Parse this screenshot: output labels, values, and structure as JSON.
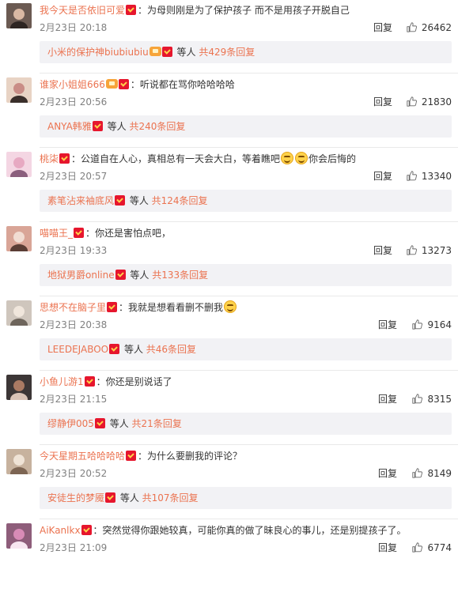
{
  "comments": [
    {
      "user": "我今天是否依旧可爱",
      "vip": false,
      "text": "：为母则刚是为了保护孩子 而不是用孩子开脱自己",
      "emoji": 0,
      "text_after": "",
      "date": "2月23日 20:18",
      "reply": "回复",
      "likes": "26462",
      "sub": {
        "name": "小米的保护神biubiubiu",
        "vip": true,
        "mid": " 等人 ",
        "count": "共429条回复"
      }
    },
    {
      "user": "谁家小姐姐666",
      "vip": true,
      "text": "：听说都在骂你哈哈哈哈",
      "emoji": 0,
      "text_after": "",
      "date": "2月23日 20:56",
      "reply": "回复",
      "likes": "21830",
      "sub": {
        "name": "ANYA韩雅",
        "vip": false,
        "mid": " 等人 ",
        "count": "共240条回复"
      }
    },
    {
      "user": "桃柒",
      "vip": false,
      "text": "：公道自在人心，真相总有一天会大白，等着瞧吧",
      "emoji": 2,
      "text_after": "你会后悔的",
      "date": "2月23日 20:57",
      "reply": "回复",
      "likes": "13340",
      "sub": {
        "name": "素笔沾来袖底风",
        "vip": false,
        "mid": " 等人 ",
        "count": "共124条回复"
      }
    },
    {
      "user": "喵喵王_",
      "vip": false,
      "text": "：你还是害怕点吧，",
      "emoji": 0,
      "text_after": "",
      "date": "2月23日 19:33",
      "reply": "回复",
      "likes": "13273",
      "sub": {
        "name": "地狱男爵online",
        "vip": false,
        "mid": " 等人 ",
        "count": "共133条回复"
      }
    },
    {
      "user": "思想不在脑子里",
      "vip": false,
      "text": "：我就是想看看删不删我",
      "emoji": 1,
      "text_after": "",
      "date": "2月23日 20:38",
      "reply": "回复",
      "likes": "9164",
      "sub": {
        "name": "LEEDEJABOO",
        "vip": false,
        "mid": " 等人 ",
        "count": "共46条回复"
      }
    },
    {
      "user": "小鱼儿游1",
      "vip": false,
      "text": "：你还是别说话了",
      "emoji": 0,
      "text_after": "",
      "date": "2月23日 21:15",
      "reply": "回复",
      "likes": "8315",
      "sub": {
        "name": "缪静伊005",
        "vip": false,
        "mid": " 等人 ",
        "count": "共21条回复"
      }
    },
    {
      "user": "今天星期五哈哈哈哈",
      "vip": false,
      "text": "：为什么要删我的评论？",
      "emoji": 0,
      "text_after": "",
      "date": "2月23日 20:52",
      "reply": "回复",
      "likes": "8149",
      "sub": {
        "name": "安徒生的梦魇",
        "vip": false,
        "mid": " 等人 ",
        "count": "共107条回复"
      }
    },
    {
      "user": "AiKanlkx",
      "vip": false,
      "text": "：突然觉得你跟她较真，可能你真的做了昧良心的事儿，还是别提孩子了。",
      "emoji": 0,
      "text_after": "",
      "date": "2月23日 21:09",
      "reply": "回复",
      "likes": "6774",
      "sub": null
    }
  ],
  "colors": {
    "username": "#eb7350",
    "text": "#333333",
    "meta": "#808080",
    "sub_bg": "#f2f2f5",
    "badge": "#e6162d"
  },
  "icons": {
    "badge": "red-badge-icon",
    "vip": "vip-crown-icon",
    "thumb": "thumbs-up-icon",
    "emoji": "smile-emoji-icon"
  }
}
